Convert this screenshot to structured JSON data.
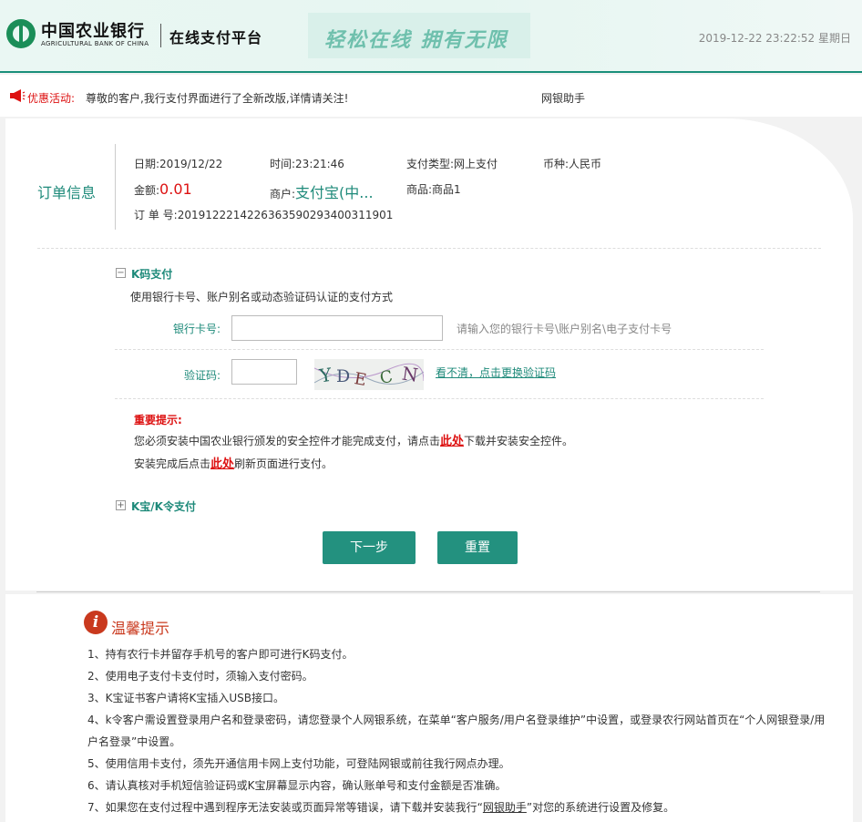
{
  "header": {
    "bank_name_cn": "中国农业银行",
    "bank_name_en": "AGRICULTURAL BANK OF CHINA",
    "platform": "在线支付平台",
    "slogan": "轻松在线  拥有无限",
    "datetime": "2019-12-22 23:22:52 星期日"
  },
  "notice": {
    "label": "优惠活动:",
    "text": "尊敬的客户,我行支付界面进行了全新改版,详情请关注!",
    "helper_link": "网银助手"
  },
  "order": {
    "title": "订单信息",
    "date_label": "日期:",
    "date": "2019/12/22",
    "time_label": "时间:",
    "time": "23:21:46",
    "pay_type_label": "支付类型:",
    "pay_type": "网上支付",
    "currency_label": "币种:",
    "currency": "人民币",
    "amount_label": "金额:",
    "amount": "0.01",
    "merchant_label": "商户:",
    "merchant": "支付宝(中...",
    "goods_label": "商品:",
    "goods": "商品1",
    "order_no_label": "订 单 号:",
    "order_no": "2019122214226363590293400311901"
  },
  "kcode": {
    "toggle": "−",
    "title": "K码支付",
    "desc": "使用银行卡号、账户别名或动态验证码认证的支付方式",
    "card_label": "银行卡号:",
    "card_hint": "请输入您的银行卡号\\账户别名\\电子支付卡号",
    "captcha_label": "验证码:",
    "captcha_text": "YDECN",
    "refresh_link": "看不清，点击更换验证码",
    "tip_title": "重要提示:",
    "tip1_prefix": "您必须安装中国农业银行颁发的安全控件才能完成支付，请点击",
    "tip1_link": "此处",
    "tip1_suffix": "下载并安装安全控件。",
    "tip2_prefix": "安装完成后点击",
    "tip2_link": "此处",
    "tip2_suffix": "刷新页面进行支付。"
  },
  "kbao": {
    "toggle": "+",
    "title": "K宝/K令支付"
  },
  "buttons": {
    "next": "下一步",
    "reset": "重置"
  },
  "tips": {
    "title": "温馨提示",
    "icon_letter": "i",
    "items": [
      "1、持有农行卡并留存手机号的客户即可进行K码支付。",
      "2、使用电子支付卡支付时，须输入支付密码。",
      "3、K宝证书客户请将K宝插入USB接口。",
      "4、k令客户需设置登录用户名和登录密码，请您登录个人网银系统，在菜单“客户服务/用户名登录维护”中设置，或登录农行网站首页在“个人网银登录/用户名登录”中设置。",
      "5、使用信用卡支付，须先开通信用卡网上支付功能，可登陆网银或前往我行网点办理。",
      "6、请认真核对手机短信验证码或K宝屏幕显示内容，确认账单号和支付金额是否准确。"
    ],
    "item7_prefix": "7、如果您在支付过程中遇到程序无法安装或页面异常等错误，请下载并安装我行“",
    "item7_link": "网银助手",
    "item7_suffix": "”对您的系统进行设置及修复。"
  }
}
